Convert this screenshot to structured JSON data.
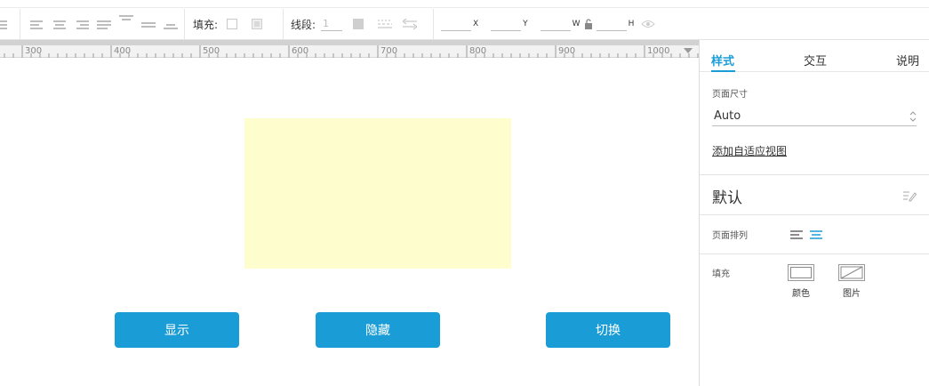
{
  "toolbar": {
    "fill_label": "填充:",
    "stroke_label": "线段:",
    "stroke_width_value": "1",
    "x_label": "X",
    "y_label": "Y",
    "w_label": "W",
    "h_label": "H"
  },
  "ruler": {
    "labels": [
      "300",
      "400",
      "500",
      "600",
      "700",
      "800",
      "900",
      "1000"
    ]
  },
  "canvas": {
    "buttons": [
      "显示",
      "隐藏",
      "切换"
    ],
    "box_color": "#fdfdcd",
    "button_color": "#1a9cd6"
  },
  "panel": {
    "tabs": [
      "样式",
      "交互",
      "说明"
    ],
    "page_size_label": "页面尺寸",
    "page_size_value": "Auto",
    "add_view_link": "添加自适应视图",
    "default_title": "默认",
    "page_align_label": "页面排列",
    "fill_label": "填充",
    "fill_color_caption": "颜色",
    "fill_image_caption": "图片",
    "accent_color": "#1a9cd6"
  }
}
